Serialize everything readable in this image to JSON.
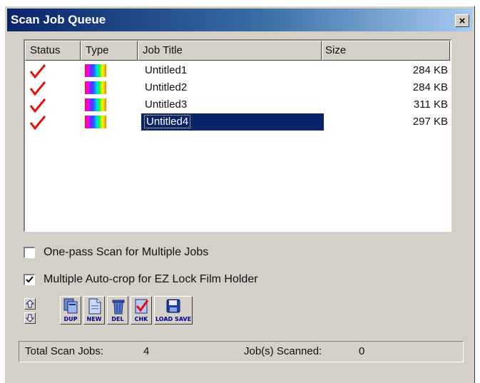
{
  "window": {
    "title": "Scan Job Queue",
    "close_symbol": "×",
    "title_gradient": [
      "#0a246a",
      "#a6caf0"
    ]
  },
  "list": {
    "columns": [
      "Status",
      "Type",
      "Job Title",
      "Size"
    ],
    "rows": [
      {
        "status": "check-icon",
        "type": "color-icon",
        "title": "Untitled1",
        "size": "284 KB",
        "selected": false
      },
      {
        "status": "check-icon",
        "type": "color-icon",
        "title": "Untitled2",
        "size": "284 KB",
        "selected": false
      },
      {
        "status": "check-icon",
        "type": "color-icon",
        "title": "Untitled3",
        "size": "311 KB",
        "selected": false
      },
      {
        "status": "check-icon",
        "type": "color-icon",
        "title": "Untitled4",
        "size": "297 KB",
        "selected": true
      }
    ],
    "selection_color": "#0a246a",
    "check_color": "#e01010"
  },
  "options": {
    "one_pass": {
      "label": "One-pass Scan for Multiple Jobs",
      "checked": false
    },
    "auto_crop": {
      "label": "Multiple Auto-crop for EZ Lock Film Holder",
      "checked": true
    }
  },
  "toolbar": {
    "dup_label": "DUP",
    "new_label": "NEW",
    "del_label": "DEL",
    "chk_label": "CHK",
    "loadsave_label": "LOAD SAVE",
    "move_up_icon": "arrow-up-icon",
    "move_down_icon": "arrow-down-icon"
  },
  "status": {
    "total_label": "Total Scan Jobs:",
    "total_value": "4",
    "scanned_label": "Job(s) Scanned:",
    "scanned_value": "0"
  }
}
